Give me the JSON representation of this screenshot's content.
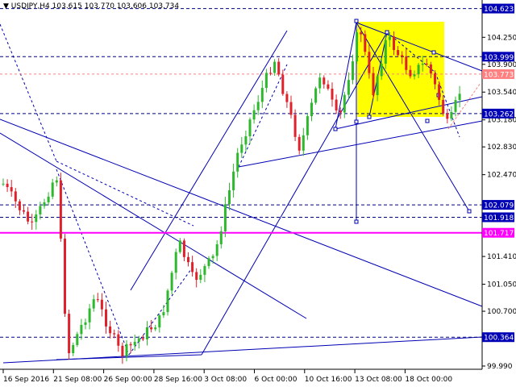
{
  "title": {
    "symbol_tf": "USDJPY,H4",
    "ohlc": "103.615 103.770 103.606 103.734"
  },
  "chart_data": {
    "type": "candlestick",
    "ylim": [
      99.99,
      104.65
    ],
    "x_tick_labels": [
      "16 Sep 2016",
      "21 Sep 08:00",
      "26 Sep 00:00",
      "28 Sep 16:00",
      "3 Oct 08:00",
      "6 Oct 00:00",
      "10 Oct 16:00",
      "13 Oct 08:00",
      "18 Oct 00:00"
    ],
    "y_tick_labels": [
      "104.250",
      "103.900",
      "103.540",
      "103.180",
      "102.830",
      "102.470",
      "101.410",
      "101.050",
      "100.700",
      "99.990"
    ],
    "y_tick_values": [
      104.25,
      103.9,
      103.54,
      103.18,
      102.83,
      102.47,
      101.41,
      101.05,
      100.7,
      99.99
    ],
    "level_labels": [
      {
        "text": "104.623",
        "value": 104.623,
        "style": "level"
      },
      {
        "text": "103.999",
        "value": 103.999,
        "style": "level"
      },
      {
        "text": "103.773",
        "value": 103.773,
        "style": "current"
      },
      {
        "text": "103.262",
        "value": 103.262,
        "style": "level"
      },
      {
        "text": "102.079",
        "value": 102.079,
        "style": "level"
      },
      {
        "text": "101.918",
        "value": 101.918,
        "style": "level"
      },
      {
        "text": "101.717",
        "value": 101.717,
        "style": "support"
      },
      {
        "text": "100.364",
        "value": 100.364,
        "style": "level"
      }
    ],
    "support_line_value": 101.717,
    "colors": {
      "up": "#2eb82e",
      "down": "#e0202a",
      "trend": "#0000b4",
      "support": "#ff00ff",
      "highlight": "#ffff00",
      "current": "#ff8080"
    }
  }
}
